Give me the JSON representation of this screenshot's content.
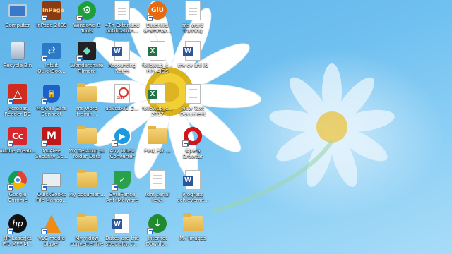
{
  "desktop": {
    "icons": [
      {
        "label": "Computer",
        "icon": "computer-icon"
      },
      {
        "label": "Recycle Bin",
        "icon": "recycle-bin-icon"
      },
      {
        "label": "Acrobat Reader DC",
        "icon": "acrobat-icon"
      },
      {
        "label": "Adobe Creati...",
        "icon": "adobe-cc-icon"
      },
      {
        "label": "Google Chrome",
        "icon": "chrome-icon"
      },
      {
        "label": "HP LaserJet Pro MFP M...",
        "icon": "hp-icon"
      },
      {
        "label": "InPage 2009",
        "icon": "inpage-icon"
      },
      {
        "label": "Intuit QuickBoo...",
        "icon": "intuit-icon"
      },
      {
        "label": "McAfee Safe Connect",
        "icon": "mcafee-safe-icon"
      },
      {
        "label": "McAfee Security Sc...",
        "icon": "mcafee-icon"
      },
      {
        "label": "QuickBooks File Manag...",
        "icon": "quickbooks-icon"
      },
      {
        "label": "VLC media player",
        "icon": "vlc-icon"
      },
      {
        "label": "Windows 8 Tools",
        "icon": "win8-tools-icon"
      },
      {
        "label": "Wondershare Filmora",
        "icon": "filmora-icon"
      },
      {
        "label": "ms word trainin...",
        "icon": "folder-icon"
      },
      {
        "label": "MY Desktop all folder Data",
        "icon": "folder-icon"
      },
      {
        "label": "My documen...",
        "icon": "folder-icon"
      },
      {
        "label": "My vidow converter file",
        "icon": "folder-icon"
      },
      {
        "label": "4Th Extended notification...",
        "icon": "document-icon"
      },
      {
        "label": "Accounting Notes",
        "icon": "word-doc-icon"
      },
      {
        "label": "advtsb02_2...",
        "icon": "pdf-icon"
      },
      {
        "label": "Any Video Converter",
        "icon": "video-converter-icon"
      },
      {
        "label": "ByteFence Anti-Malware",
        "icon": "bytefence-icon"
      },
      {
        "label": "Dates are the specialty cr...",
        "icon": "word-doc-icon"
      },
      {
        "label": "Essential Grammar...",
        "icon": "giu-icon"
      },
      {
        "label": "followup_c... HIV AIDS",
        "icon": "excel-icon"
      },
      {
        "label": "followup_c... 2017",
        "icon": "excel-icon"
      },
      {
        "label": "Fwd_Fw_...",
        "icon": "folder-icon"
      },
      {
        "label": "idm serial keys",
        "icon": "document-icon"
      },
      {
        "label": "Internet Downlo...",
        "icon": "idm-icon"
      },
      {
        "label": "ms word training",
        "icon": "document-icon"
      },
      {
        "label": "my cv uni id",
        "icon": "word-doc-icon"
      },
      {
        "label": "New Text Document",
        "icon": "document-icon"
      },
      {
        "label": "Opera Browser",
        "icon": "opera-icon"
      },
      {
        "label": "Progress achieveme...",
        "icon": "word-doc-icon"
      },
      {
        "label": "My images",
        "icon": "folder-icon"
      }
    ]
  }
}
